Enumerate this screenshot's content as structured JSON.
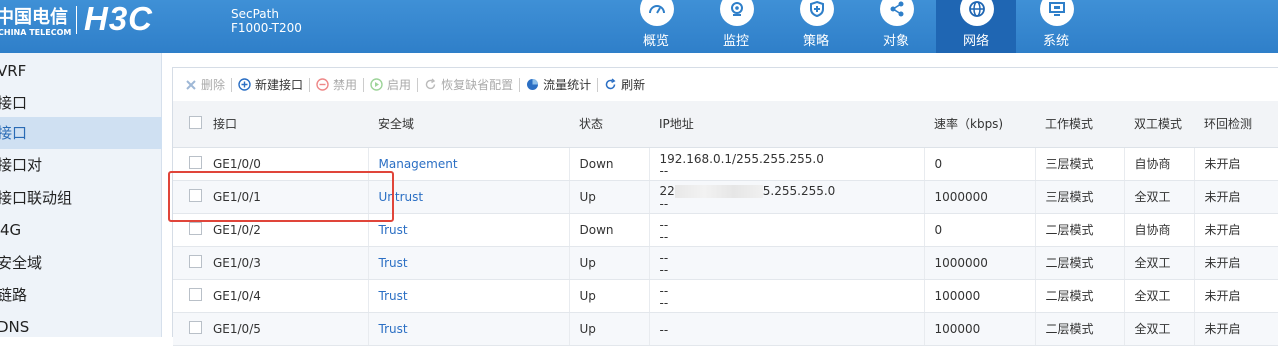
{
  "brand": {
    "telecom_cn": "中国电信",
    "telecom_en": "CHINA TELECOM",
    "logo": "H3C",
    "product": "SecPath",
    "model": "F1000-T200"
  },
  "nav": [
    {
      "label": "概览",
      "icon": "gauge-icon"
    },
    {
      "label": "监控",
      "icon": "camera-icon"
    },
    {
      "label": "策略",
      "icon": "shield-icon"
    },
    {
      "label": "对象",
      "icon": "share-icon"
    },
    {
      "label": "网络",
      "icon": "globe-icon",
      "active": true
    },
    {
      "label": "系统",
      "icon": "monitor-icon"
    }
  ],
  "sidebar": {
    "items": [
      {
        "label": "VRF"
      },
      {
        "label": "接口"
      },
      {
        "label": "接口",
        "active": true
      },
      {
        "label": "接口对"
      },
      {
        "label": "接口联动组"
      },
      {
        "label": "4G"
      },
      {
        "label": "安全域"
      },
      {
        "label": "链路"
      },
      {
        "label": "DNS"
      }
    ]
  },
  "toolbar": {
    "delete": "删除",
    "new_interface": "新建接口",
    "disable": "禁用",
    "enable": "启用",
    "restore_default": "恢复缺省配置",
    "traffic_stats": "流量统计",
    "refresh": "刷新"
  },
  "table": {
    "headers": {
      "interface": "接口",
      "zone": "安全域",
      "status": "状态",
      "ip": "IP地址",
      "rate": "速率（kbps)",
      "work_mode": "工作模式",
      "duplex": "双工模式",
      "loopback": "环回检测"
    },
    "rows": [
      {
        "interface": "GE1/0/0",
        "zone": "Management",
        "status": "Down",
        "ip1": "192.168.0.1/255.255.255.0",
        "ip2": "--",
        "rate": "0",
        "work_mode": "三层模式",
        "duplex": "自协商",
        "loopback": "未开启"
      },
      {
        "interface": "GE1/0/1",
        "zone": "Untrust",
        "status": "Up",
        "ip1a": "22",
        "ip1b": "5.255.255.0",
        "ip2": "--",
        "rate": "1000000",
        "work_mode": "三层模式",
        "duplex": "全双工",
        "loopback": "未开启"
      },
      {
        "interface": "GE1/0/2",
        "zone": "Trust",
        "status": "Down",
        "ip1": "--",
        "ip2": "--",
        "rate": "0",
        "work_mode": "二层模式",
        "duplex": "自协商",
        "loopback": "未开启"
      },
      {
        "interface": "GE1/0/3",
        "zone": "Trust",
        "status": "Up",
        "ip1": "--",
        "ip2": "--",
        "rate": "1000000",
        "work_mode": "二层模式",
        "duplex": "全双工",
        "loopback": "未开启"
      },
      {
        "interface": "GE1/0/4",
        "zone": "Trust",
        "status": "Up",
        "ip1": "--",
        "ip2": "--",
        "rate": "100000",
        "work_mode": "二层模式",
        "duplex": "全双工",
        "loopback": "未开启"
      },
      {
        "interface": "GE1/0/5",
        "zone": "Trust",
        "status": "Up",
        "ip1": "--",
        "ip2": "",
        "rate": "100000",
        "work_mode": "二层模式",
        "duplex": "全双工",
        "loopback": "未开启"
      }
    ]
  },
  "colors": {
    "header": "#2f7fc9",
    "nav_active": "#1f66b3",
    "link": "#2b6fc4",
    "highlight": "#e0453a"
  }
}
